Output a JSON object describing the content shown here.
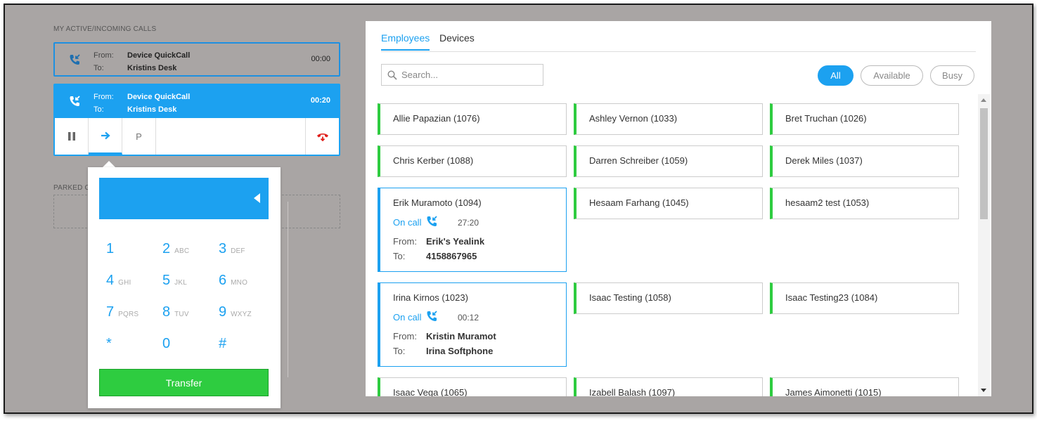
{
  "left": {
    "active_calls_label": "MY ACTIVE/INCOMING CALLS",
    "parked_label": "PARKED C",
    "calls": [
      {
        "from_label": "From:",
        "to_label": "To:",
        "from": "Device QuickCall",
        "to": "Kristins Desk",
        "time": "00:00"
      },
      {
        "from_label": "From:",
        "to_label": "To:",
        "from": "Device QuickCall",
        "to": "Kristins Desk",
        "time": "00:20"
      }
    ],
    "controls": {
      "park_label": "P"
    }
  },
  "dialpad": {
    "keys": [
      {
        "d": "1",
        "l": ""
      },
      {
        "d": "2",
        "l": "ABC"
      },
      {
        "d": "3",
        "l": "DEF"
      },
      {
        "d": "4",
        "l": "GHI"
      },
      {
        "d": "5",
        "l": "JKL"
      },
      {
        "d": "6",
        "l": "MNO"
      },
      {
        "d": "7",
        "l": "PQRS"
      },
      {
        "d": "8",
        "l": "TUV"
      },
      {
        "d": "9",
        "l": "WXYZ"
      },
      {
        "d": "*",
        "l": ""
      },
      {
        "d": "0",
        "l": ""
      },
      {
        "d": "#",
        "l": ""
      }
    ],
    "transfer_label": "Transfer"
  },
  "right": {
    "tabs": [
      "Employees",
      "Devices"
    ],
    "search_placeholder": "Search...",
    "filters": [
      "All",
      "Available",
      "Busy"
    ],
    "employees": [
      {
        "name": "Allie Papazian (1076)"
      },
      {
        "name": "Ashley Vernon (1033)"
      },
      {
        "name": "Bret Truchan (1026)"
      },
      {
        "name": "Chris Kerber (1088)"
      },
      {
        "name": "Darren Schreiber (1059)"
      },
      {
        "name": "Derek Miles (1037)"
      },
      {
        "name": "Erik Muramoto (1094)",
        "status": "On call",
        "duration": "27:20",
        "from_label": "From:",
        "to_label": "To:",
        "from": "Erik's Yealink",
        "to": "4158867965"
      },
      {
        "name": "Hesaam Farhang (1045)"
      },
      {
        "name": "hesaam2 test (1053)"
      },
      {
        "name": "Irina Kirnos (1023)",
        "status": "On call",
        "duration": "00:12",
        "from_label": "From:",
        "to_label": "To:",
        "from": "Kristin Muramot",
        "to": "Irina Softphone"
      },
      {
        "name": "Isaac Testing (1058)"
      },
      {
        "name": "Isaac Testing23 (1084)"
      },
      {
        "name": "Isaac Vega (1065)"
      },
      {
        "name": "Izabell Balash (1097)"
      },
      {
        "name": "James Aimonetti (1015)"
      }
    ]
  },
  "colors": {
    "accent": "#1ca1f0",
    "available": "#2ecc40",
    "hangup": "#e0201c",
    "backdrop": "#a9a5a4"
  }
}
